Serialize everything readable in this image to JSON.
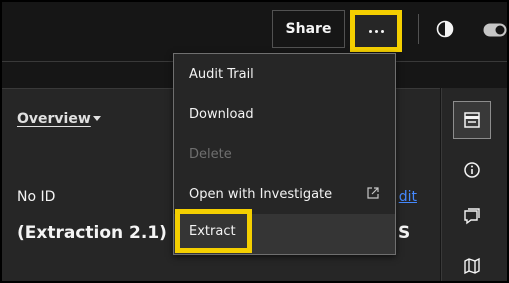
{
  "toolbar": {
    "share_label": "Share",
    "more_icon": "overflow-menu-horizontal-icon",
    "contrast_icon": "contrast-icon",
    "toggle_icon": "toggle-icon"
  },
  "menu": {
    "items": [
      {
        "label": "Audit Trail",
        "enabled": true
      },
      {
        "label": "Download",
        "enabled": true
      },
      {
        "label": "Delete",
        "enabled": false
      },
      {
        "label": "Open with Investigate",
        "enabled": true,
        "icon": "launch-icon"
      },
      {
        "label": "Extract",
        "enabled": true,
        "highlighted": true
      }
    ]
  },
  "content": {
    "overview_label": "Overview",
    "id_label": "No ID",
    "edit_label": "dit",
    "title_visible": "(Extraction 2.1) (E",
    "title_suffix": "S"
  },
  "rail": {
    "items": [
      {
        "icon": "document-icon",
        "active": true
      },
      {
        "icon": "information-icon",
        "active": false
      },
      {
        "icon": "chat-icon",
        "active": false
      },
      {
        "icon": "map-icon",
        "active": false
      }
    ]
  },
  "colors": {
    "background": "#161616",
    "panel": "#262626",
    "highlight_annotation": "#f4cf00",
    "link": "#4589ff",
    "disabled_text": "#6f6f6f"
  }
}
